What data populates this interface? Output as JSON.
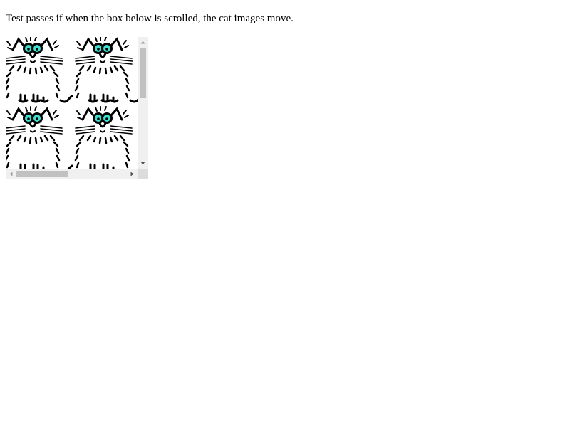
{
  "instruction": {
    "text": "Test passes if when the box below is scrolled, the cat images move."
  },
  "scroll_box": {
    "image": {
      "name": "cat",
      "columns": 2,
      "rows": 2
    },
    "vertical_scroll_fraction": 0.0,
    "horizontal_scroll_fraction": 0.0
  },
  "colors": {
    "line": "#000000",
    "eyes": "#40e0d0",
    "scrollbar_track": "#f0f0f0",
    "scrollbar_thumb": "#c1c1c1",
    "scrollbar_arrow": "#505050"
  }
}
